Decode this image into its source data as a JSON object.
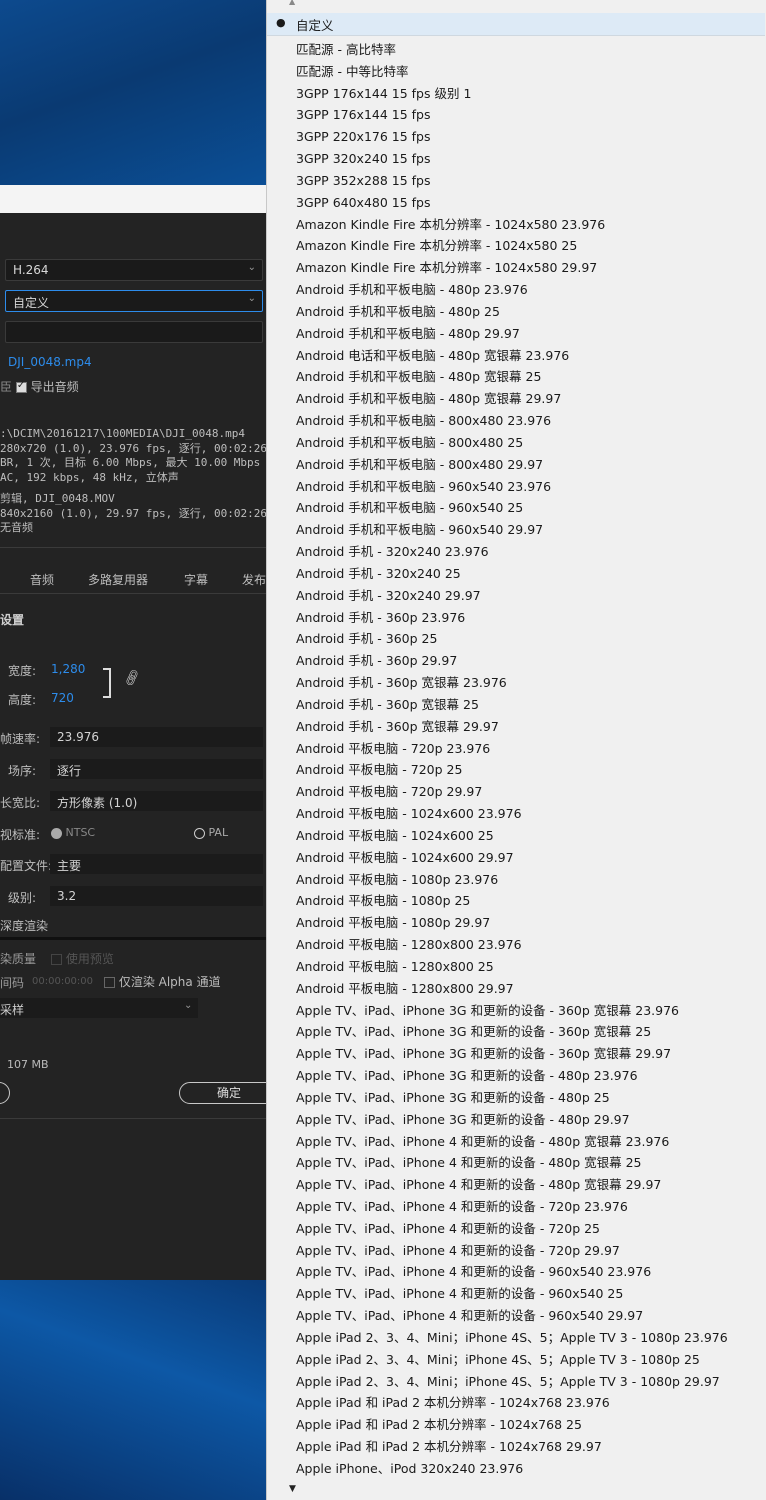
{
  "dialog": {
    "format": "H.264",
    "preset": "自定义",
    "comment": "",
    "output_name": "DJI_0048.mp4",
    "export_audio_label": "导出音频",
    "summary_output": [
      ":\\DCIM\\20161217\\100MEDIA\\DJI_0048.mp4",
      "280x720 (1.0), 23.976 fps, 逐行, 00:02:26:01",
      "BR, 1 次, 目标 6.00 Mbps, 最大 10.00 Mbps",
      "AC, 192 kbps, 48 kHz, 立体声"
    ],
    "summary_source": [
      "剪辑, DJI_0048.MOV",
      "840x2160 (1.0), 29.97 fps, 逐行, 00:02:26:02",
      "无音频"
    ],
    "tabs": [
      "音频",
      "多路复用器",
      "字幕",
      "发布"
    ],
    "section_title": "设置",
    "width_label": "宽度:",
    "width_value": "1,280",
    "height_label": "高度:",
    "height_value": "720",
    "frame_rate_label": "帧速率:",
    "frame_rate_value": "23.976",
    "field_order_label": "场序:",
    "field_order_value": "逐行",
    "aspect_label": "长宽比:",
    "aspect_value": "方形像素 (1.0)",
    "tv_standard_label": "视标准:",
    "ntsc_label": "NTSC",
    "pal_label": "PAL",
    "profile_label": "配置文件:",
    "profile_value": "主要",
    "level_label": "级别:",
    "level_value": "3.2",
    "max_depth_label": "深度渲染",
    "render_quality_label": "染质量",
    "use_preview_label": "使用预览",
    "timecode_label": "间码",
    "timecode_value": "00:00:00:00",
    "alpha_only_label": "仅渲染 Alpha 通道",
    "sampling_value": "采样",
    "file_size": "107 MB",
    "ok_label": "确定"
  },
  "dropdown": {
    "selected": "自定义",
    "items": [
      "匹配源 - 高比特率",
      "匹配源 - 中等比特率",
      "3GPP 176x144 15 fps 级别 1",
      "3GPP 176x144 15 fps",
      "3GPP 220x176 15 fps",
      "3GPP 320x240 15 fps",
      "3GPP 352x288 15 fps",
      "3GPP 640x480 15 fps",
      "Amazon Kindle Fire 本机分辨率 - 1024x580 23.976",
      "Amazon Kindle Fire 本机分辨率 - 1024x580 25",
      "Amazon Kindle Fire 本机分辨率 - 1024x580 29.97",
      "Android 手机和平板电脑 - 480p 23.976",
      "Android 手机和平板电脑 - 480p 25",
      "Android 手机和平板电脑 - 480p 29.97",
      "Android 电话和平板电脑 - 480p 宽银幕 23.976",
      "Android 手机和平板电脑 - 480p 宽银幕 25",
      "Android 手机和平板电脑 - 480p 宽银幕 29.97",
      "Android 手机和平板电脑 - 800x480 23.976",
      "Android 手机和平板电脑 - 800x480 25",
      "Android 手机和平板电脑 - 800x480 29.97",
      "Android 手机和平板电脑 - 960x540 23.976",
      "Android 手机和平板电脑 - 960x540 25",
      "Android 手机和平板电脑 - 960x540 29.97",
      "Android 手机 - 320x240 23.976",
      "Android 手机 - 320x240 25",
      "Android 手机 - 320x240 29.97",
      "Android 手机 - 360p 23.976",
      "Android 手机 - 360p 25",
      "Android 手机 - 360p 29.97",
      "Android 手机 - 360p 宽银幕 23.976",
      "Android 手机 - 360p 宽银幕 25",
      "Android 手机 - 360p 宽银幕 29.97",
      "Android 平板电脑 - 720p 23.976",
      "Android 平板电脑 - 720p 25",
      "Android 平板电脑 - 720p 29.97",
      "Android 平板电脑 - 1024x600 23.976",
      "Android 平板电脑 - 1024x600 25",
      "Android 平板电脑 - 1024x600 29.97",
      "Android 平板电脑 - 1080p 23.976",
      "Android 平板电脑 - 1080p 25",
      "Android 平板电脑 - 1080p 29.97",
      "Android 平板电脑 - 1280x800 23.976",
      "Android 平板电脑 - 1280x800 25",
      "Android 平板电脑 - 1280x800 29.97",
      "Apple TV、iPad、iPhone 3G 和更新的设备 - 360p 宽银幕 23.976",
      "Apple TV、iPad、iPhone 3G 和更新的设备 - 360p 宽银幕 25",
      "Apple TV、iPad、iPhone 3G 和更新的设备 - 360p 宽银幕 29.97",
      "Apple TV、iPad、iPhone 3G 和更新的设备 - 480p 23.976",
      "Apple TV、iPad、iPhone 3G 和更新的设备 - 480p 25",
      "Apple TV、iPad、iPhone 3G 和更新的设备 - 480p 29.97",
      "Apple TV、iPad、iPhone 4 和更新的设备 - 480p 宽银幕 23.976",
      "Apple TV、iPad、iPhone 4 和更新的设备 - 480p 宽银幕 25",
      "Apple TV、iPad、iPhone 4 和更新的设备 - 480p 宽银幕 29.97",
      "Apple TV、iPad、iPhone 4 和更新的设备 - 720p 23.976",
      "Apple TV、iPad、iPhone 4 和更新的设备 - 720p 25",
      "Apple TV、iPad、iPhone 4 和更新的设备 - 720p 29.97",
      "Apple TV、iPad、iPhone 4 和更新的设备 - 960x540 23.976",
      "Apple TV、iPad、iPhone 4 和更新的设备 - 960x540 25",
      "Apple TV、iPad、iPhone 4 和更新的设备 - 960x540 29.97",
      "Apple iPad 2、3、4、Mini；iPhone 4S、5；Apple TV 3 - 1080p 23.976",
      "Apple iPad 2、3、4、Mini；iPhone 4S、5；Apple TV 3 - 1080p 25",
      "Apple iPad 2、3、4、Mini；iPhone 4S、5；Apple TV 3 - 1080p 29.97",
      "Apple iPad 和 iPad 2 本机分辨率 - 1024x768 23.976",
      "Apple iPad 和 iPad 2 本机分辨率 - 1024x768 25",
      "Apple iPad 和 iPad 2 本机分辨率 - 1024x768 29.97",
      "Apple iPhone、iPod 320x240 23.976"
    ]
  }
}
